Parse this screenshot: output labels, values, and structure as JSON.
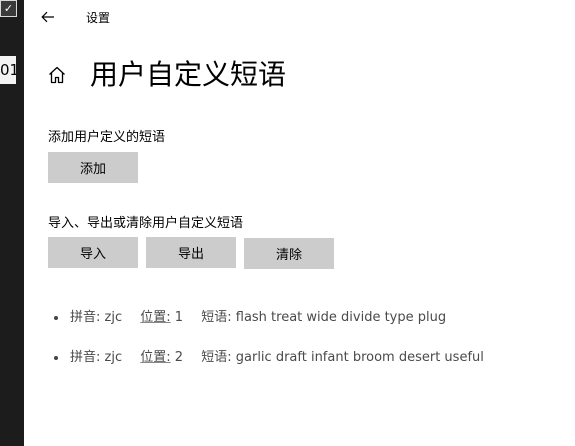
{
  "background": {
    "checkbox_glyph": "✓",
    "field_text": "01"
  },
  "titlebar": {
    "title": "设置",
    "back_icon": "back-arrow-icon"
  },
  "header": {
    "home_icon": "home-icon",
    "page_title": "用户自定义短语"
  },
  "add_section": {
    "label": "添加用户定义的短语",
    "add_button": "添加"
  },
  "manage_section": {
    "label": "导入、导出或清除用户自定义短语",
    "import_button": "导入",
    "export_button": "导出",
    "clear_button": "清除"
  },
  "phrases": [
    {
      "pinyin_label": "拼音:",
      "pinyin": "zjc",
      "position_label": "位置:",
      "position": "1",
      "phrase_label": "短语:",
      "phrase": "flash treat wide divide type plug"
    },
    {
      "pinyin_label": "拼音:",
      "pinyin": "zjc",
      "position_label": "位置:",
      "position": "2",
      "phrase_label": "短语:",
      "phrase": "garlic draft infant broom desert useful"
    }
  ],
  "colors": {
    "button_bg": "#cccccc",
    "window_bg": "#ffffff",
    "phrase_text": "#4a4a4a"
  }
}
